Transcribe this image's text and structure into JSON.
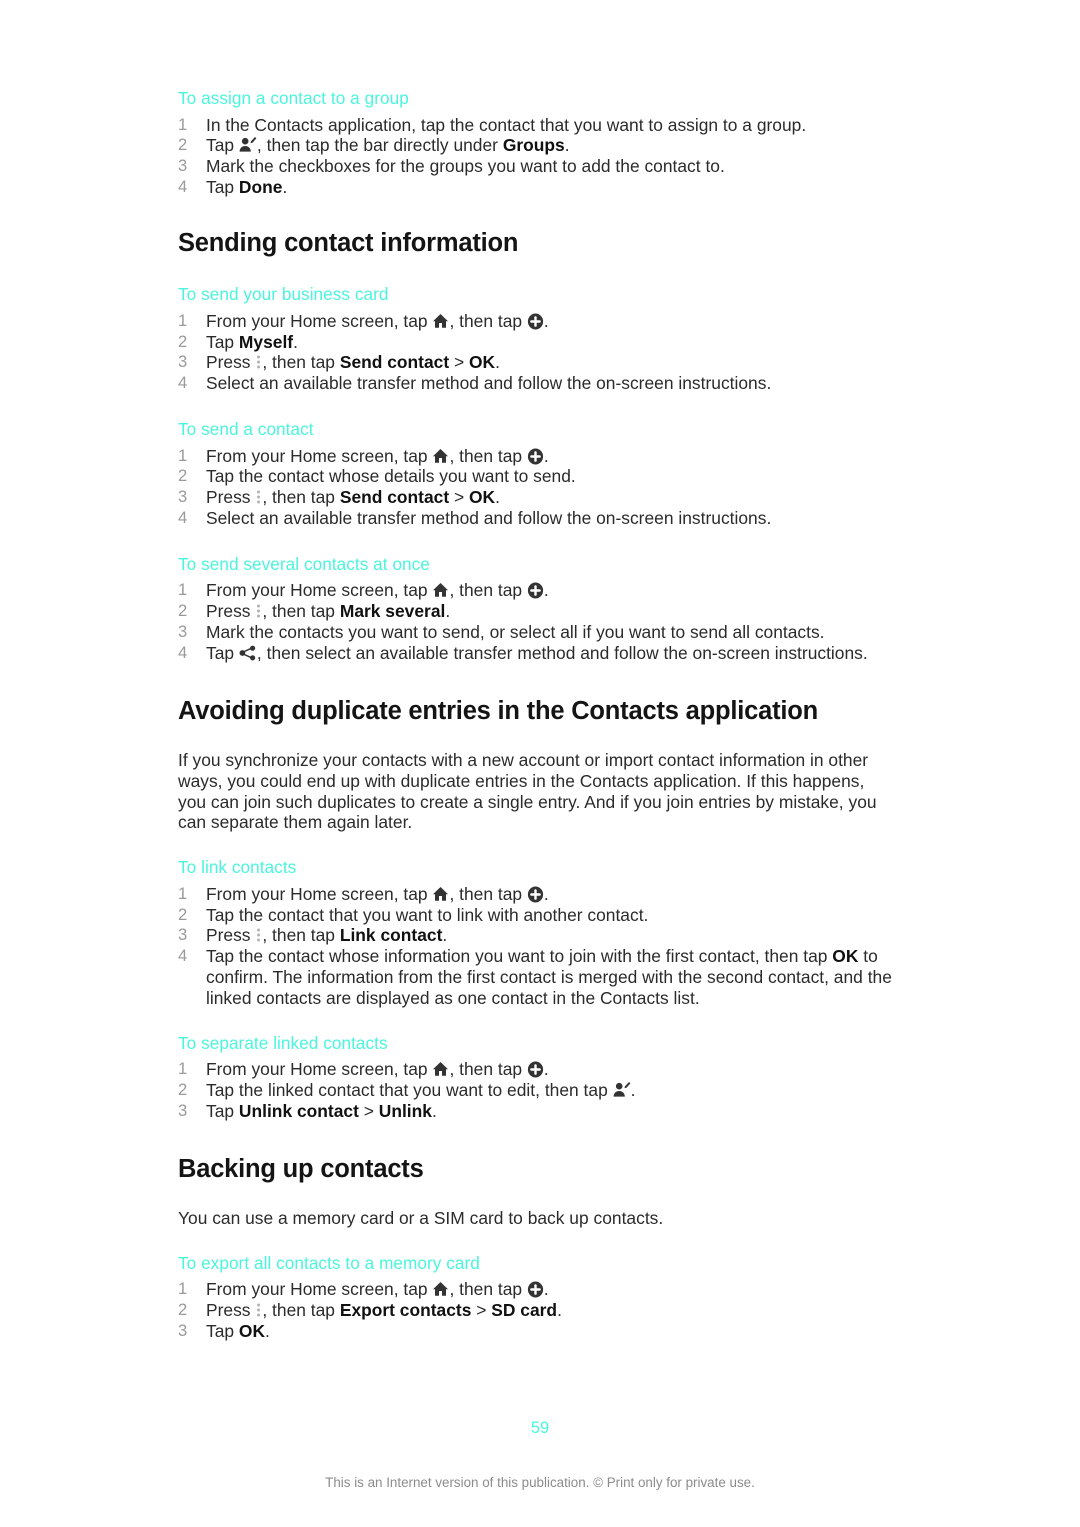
{
  "document": {
    "page_number": "59",
    "footer_note": "This is an Internet version of this publication. © Print only for private use.",
    "heading_color": "#4BF5DC"
  },
  "sections": [
    {
      "id": "assign-contact-group",
      "type": "procedure",
      "sub_head": "To assign a contact to a group",
      "steps": [
        "In the Contacts application, tap the contact that you want to assign to a group.",
        "Tap [person-edit-icon], then tap the bar directly under Groups.",
        "Mark the checkboxes for the groups you want to add the contact to.",
        "Tap Done."
      ],
      "step_parts": {
        "s1": "In the Contacts application, tap the contact that you want to assign to a group.",
        "s2_a": "Tap ",
        "s2_b": ", then tap the bar directly under ",
        "s2_bold": "Groups",
        "s2_c": ".",
        "s3": "Mark the checkboxes for the groups you want to add the contact to.",
        "s4_a": "Tap ",
        "s4_bold": "Done",
        "s4_b": "."
      }
    },
    {
      "id": "sending-contact-information",
      "type": "section",
      "title": "Sending contact information"
    },
    {
      "id": "send-business-card",
      "type": "procedure",
      "sub_head": "To send your business card",
      "step_parts": {
        "s1_a": "From your Home screen, tap ",
        "s1_b": ", then tap ",
        "s1_c": ".",
        "s2_a": "Tap ",
        "s2_bold": "Myself",
        "s2_b": ".",
        "s3_a": "Press ",
        "s3_b": ", then tap ",
        "s3_bold1": "Send contact",
        "s3_gt": " > ",
        "s3_bold2": "OK",
        "s3_c": ".",
        "s4": "Select an available transfer method and follow the on-screen instructions."
      }
    },
    {
      "id": "send-a-contact",
      "type": "procedure",
      "sub_head": "To send a contact",
      "step_parts": {
        "s1_a": "From your Home screen, tap ",
        "s1_b": ", then tap ",
        "s1_c": ".",
        "s2": "Tap the contact whose details you want to send.",
        "s3_a": "Press ",
        "s3_b": ", then tap ",
        "s3_bold1": "Send contact",
        "s3_gt": " > ",
        "s3_bold2": "OK",
        "s3_c": ".",
        "s4": "Select an available transfer method and follow the on-screen instructions."
      }
    },
    {
      "id": "send-several-contacts",
      "type": "procedure",
      "sub_head": "To send several contacts at once",
      "step_parts": {
        "s1_a": "From your Home screen, tap ",
        "s1_b": ", then tap ",
        "s1_c": ".",
        "s2_a": "Press ",
        "s2_b": ", then tap ",
        "s2_bold": "Mark several",
        "s2_c": ".",
        "s3": "Mark the contacts you want to send, or select all if you want to send all contacts.",
        "s4_a": "Tap ",
        "s4_b": ", then select an available transfer method and follow the on-screen instructions."
      }
    },
    {
      "id": "avoiding-duplicates",
      "type": "section",
      "title": "Avoiding duplicate entries in the Contacts application",
      "paragraph": "If you synchronize your contacts with a new account or import contact information in other ways, you could end up with duplicate entries in the Contacts application. If this happens, you can join such duplicates to create a single entry. And if you join entries by mistake, you can separate them again later."
    },
    {
      "id": "link-contacts",
      "type": "procedure",
      "sub_head": "To link contacts",
      "step_parts": {
        "s1_a": "From your Home screen, tap ",
        "s1_b": ", then tap ",
        "s1_c": ".",
        "s2": "Tap the contact that you want to link with another contact.",
        "s3_a": "Press ",
        "s3_b": ", then tap ",
        "s3_bold": "Link contact",
        "s3_c": ".",
        "s4_a": "Tap the contact whose information you want to join with the first contact, then tap ",
        "s4_bold": "OK",
        "s4_b": " to confirm. The information from the first contact is merged with the second contact, and the linked contacts are displayed as one contact in the Contacts list."
      }
    },
    {
      "id": "separate-linked-contacts",
      "type": "procedure",
      "sub_head": "To separate linked contacts",
      "step_parts": {
        "s1_a": "From your Home screen, tap ",
        "s1_b": ", then tap ",
        "s1_c": ".",
        "s2_a": "Tap the linked contact that you want to edit, then tap ",
        "s2_b": ".",
        "s3_a": "Tap ",
        "s3_bold1": "Unlink contact",
        "s3_gt": " > ",
        "s3_bold2": "Unlink",
        "s3_c": "."
      }
    },
    {
      "id": "backing-up-contacts",
      "type": "section",
      "title": "Backing up contacts",
      "paragraph": "You can use a memory card or a SIM card to back up contacts."
    },
    {
      "id": "export-all-contacts",
      "type": "procedure",
      "sub_head": "To export all contacts to a memory card",
      "step_parts": {
        "s1_a": "From your Home screen, tap ",
        "s1_b": ", then tap ",
        "s1_c": ".",
        "s2_a": "Press ",
        "s2_b": ", then tap ",
        "s2_bold1": "Export contacts",
        "s2_gt": " > ",
        "s2_bold2": "SD card",
        "s2_c": ".",
        "s3_a": "Tap ",
        "s3_bold": "OK",
        "s3_b": "."
      }
    }
  ],
  "icons": {
    "home": "home-icon",
    "contact": "contacts-app-icon",
    "person_edit": "person-edit-icon",
    "share": "share-icon",
    "menu": "overflow-menu-icon"
  }
}
